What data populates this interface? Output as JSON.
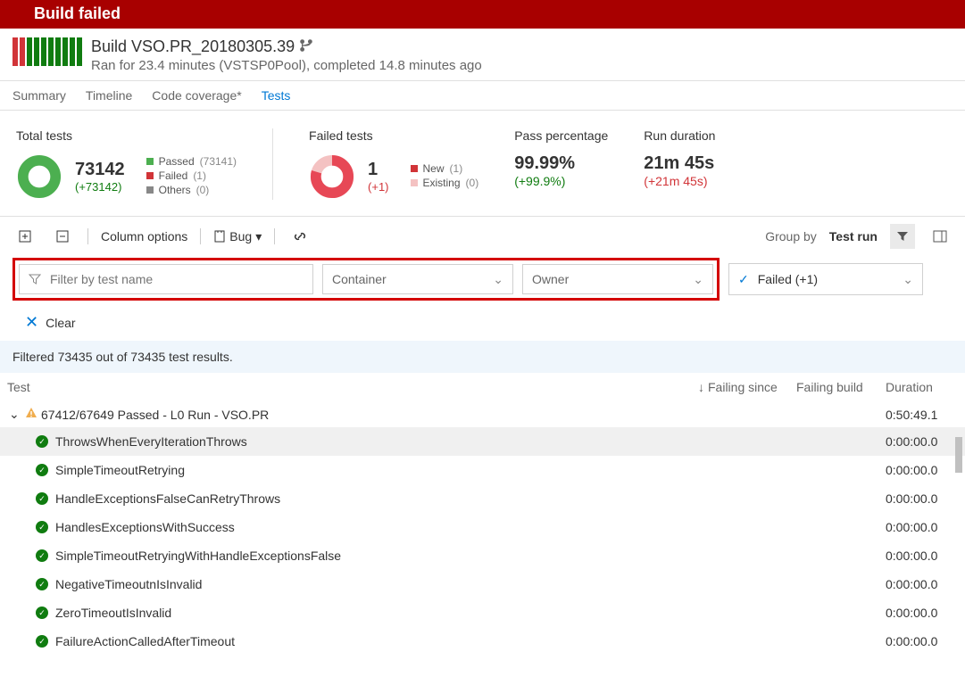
{
  "titlebar": "Build failed",
  "header": {
    "title": "Build VSO.PR_20180305.39",
    "subtitle": "Ran for 23.4 minutes (VSTSP0Pool), completed 14.8 minutes ago"
  },
  "tabs": [
    "Summary",
    "Timeline",
    "Code coverage*",
    "Tests"
  ],
  "stats": {
    "total": {
      "title": "Total tests",
      "value": "73142",
      "delta": "(+73142)",
      "legend": [
        {
          "label": "Passed",
          "count": "(73141)"
        },
        {
          "label": "Failed",
          "count": "(1)"
        },
        {
          "label": "Others",
          "count": "(0)"
        }
      ]
    },
    "failed": {
      "title": "Failed tests",
      "value": "1",
      "delta": "(+1)",
      "legend": [
        {
          "label": "New",
          "count": "(1)"
        },
        {
          "label": "Existing",
          "count": "(0)"
        }
      ]
    },
    "pass": {
      "title": "Pass percentage",
      "value": "99.99%",
      "delta": "(+99.9%)"
    },
    "duration": {
      "title": "Run duration",
      "value": "21m 45s",
      "delta": "(+21m 45s)"
    }
  },
  "toolbar": {
    "columns": "Column options",
    "bug": "Bug",
    "groupby_label": "Group by",
    "groupby_value": "Test run"
  },
  "filters": {
    "name_placeholder": "Filter by test name",
    "container": "Container",
    "owner": "Owner",
    "outcome": "Failed (+1)"
  },
  "clear_label": "Clear",
  "banner": "Filtered 73435 out of 73435 test results.",
  "columns": {
    "test": "Test",
    "since": "Failing since",
    "build": "Failing build",
    "duration": "Duration"
  },
  "group": {
    "label": "67412/67649 Passed - L0 Run - VSO.PR",
    "duration": "0:50:49.1"
  },
  "tests": [
    {
      "name": "ThrowsWhenEveryIterationThrows",
      "duration": "0:00:00.0"
    },
    {
      "name": "SimpleTimeoutRetrying",
      "duration": "0:00:00.0"
    },
    {
      "name": "HandleExceptionsFalseCanRetryThrows",
      "duration": "0:00:00.0"
    },
    {
      "name": "HandlesExceptionsWithSuccess",
      "duration": "0:00:00.0"
    },
    {
      "name": "SimpleTimeoutRetryingWithHandleExceptionsFalse",
      "duration": "0:00:00.0"
    },
    {
      "name": "NegativeTimeoutnIsInvalid",
      "duration": "0:00:00.0"
    },
    {
      "name": "ZeroTimeoutIsInvalid",
      "duration": "0:00:00.0"
    },
    {
      "name": "FailureActionCalledAfterTimeout",
      "duration": "0:00:00.0"
    }
  ]
}
